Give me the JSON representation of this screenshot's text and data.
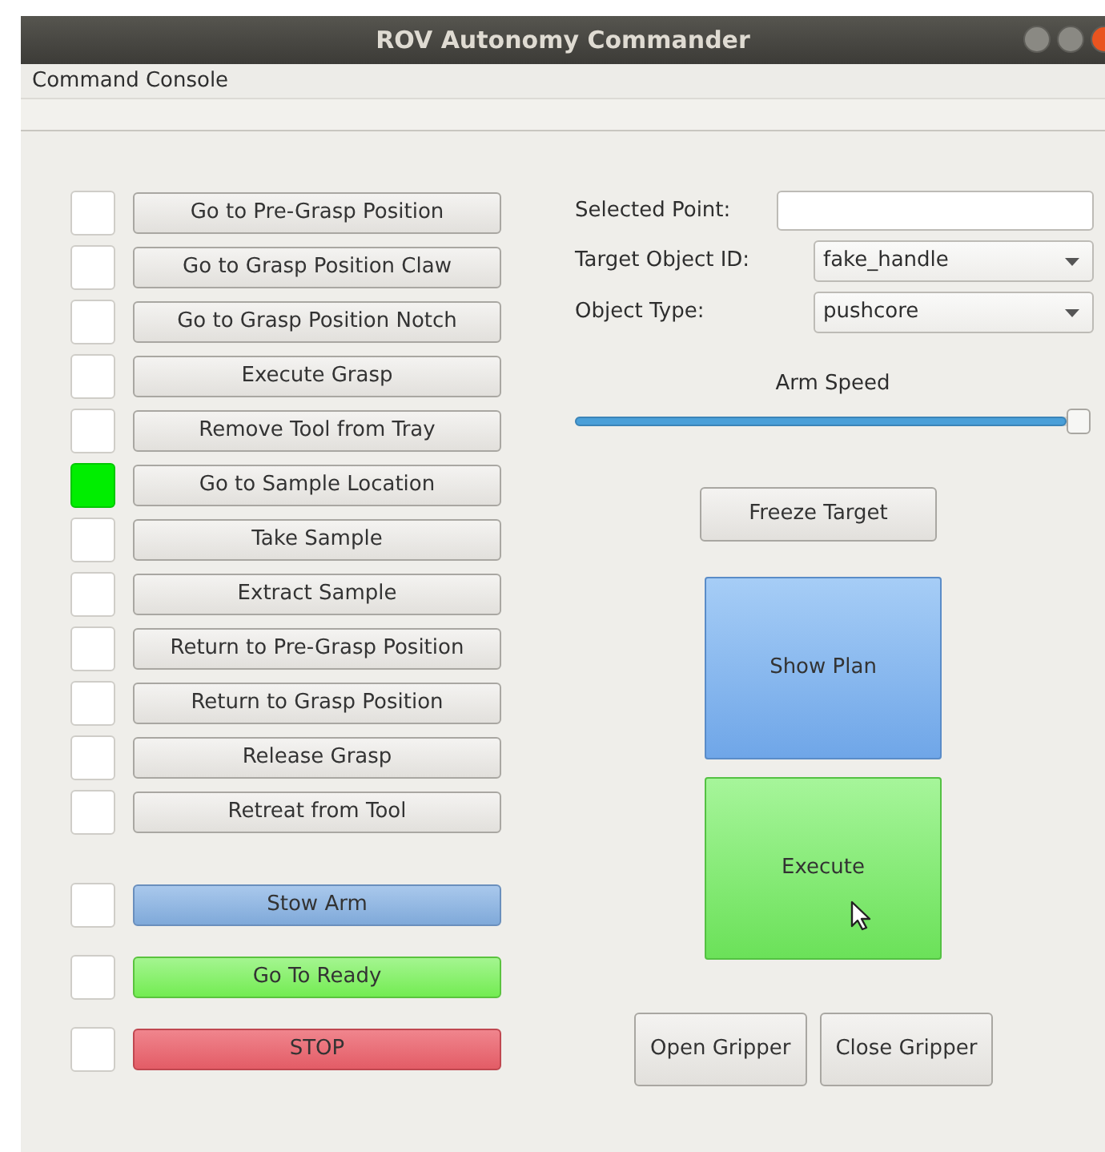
{
  "window": {
    "title": "ROV Autonomy Commander"
  },
  "menu": [
    "Command Console"
  ],
  "steps": [
    {
      "label": "Go to Pre-Grasp Position",
      "active": false
    },
    {
      "label": "Go to Grasp Position Claw",
      "active": false
    },
    {
      "label": "Go to Grasp Position Notch",
      "active": false
    },
    {
      "label": "Execute Grasp",
      "active": false
    },
    {
      "label": "Remove Tool from Tray",
      "active": false
    },
    {
      "label": "Go to Sample Location",
      "active": true
    },
    {
      "label": "Take Sample",
      "active": false
    },
    {
      "label": "Extract Sample",
      "active": false
    },
    {
      "label": "Return to Pre-Grasp Position",
      "active": false
    },
    {
      "label": "Return to Grasp Position",
      "active": false
    },
    {
      "label": "Release Grasp",
      "active": false
    },
    {
      "label": "Retreat from Tool",
      "active": false
    }
  ],
  "quick_actions": [
    {
      "label": "Stow Arm",
      "active": false,
      "kind": "stow"
    },
    {
      "label": "Go To Ready",
      "active": false,
      "kind": "ready"
    },
    {
      "label": "STOP",
      "active": false,
      "kind": "stop"
    }
  ],
  "form": [
    {
      "label": "Selected Point:",
      "kind": "text"
    },
    {
      "label": "Target Object ID:",
      "kind": "select",
      "value": "fake_handle"
    },
    {
      "label": "Object Type:",
      "kind": "select",
      "value": "pushcore"
    }
  ],
  "arm_speed": {
    "label": "Arm Speed",
    "level": 1.0
  },
  "freeze_button": "Freeze Target",
  "plan_button": "Show Plan",
  "execute_button": "Execute",
  "gripper_buttons": [
    "Open Gripper",
    "Close Gripper"
  ]
}
